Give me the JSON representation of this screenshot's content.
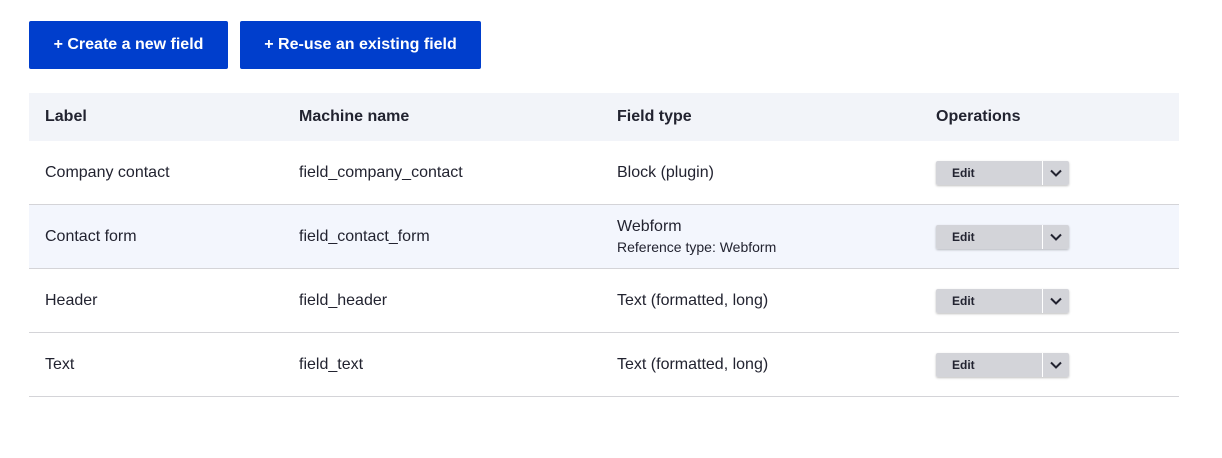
{
  "actions": {
    "create_label": "+ Create a new field",
    "reuse_label": "+ Re-use an existing field",
    "button_color": "#003ecc"
  },
  "table": {
    "headers": {
      "label": "Label",
      "machine_name": "Machine name",
      "field_type": "Field type",
      "operations": "Operations"
    },
    "rows": [
      {
        "label": "Company contact",
        "machine_name": "field_company_contact",
        "field_type": "Block (plugin)",
        "sub": "",
        "op": "Edit"
      },
      {
        "label": "Contact form",
        "machine_name": "field_contact_form",
        "field_type": "Webform",
        "sub": "Reference type: Webform",
        "op": "Edit"
      },
      {
        "label": "Header",
        "machine_name": "field_header",
        "field_type": "Text (formatted, long)",
        "sub": "",
        "op": "Edit"
      },
      {
        "label": "Text",
        "machine_name": "field_text",
        "field_type": "Text (formatted, long)",
        "sub": "",
        "op": "Edit"
      }
    ]
  },
  "icons": {
    "toggle": "chevron-down-icon"
  }
}
